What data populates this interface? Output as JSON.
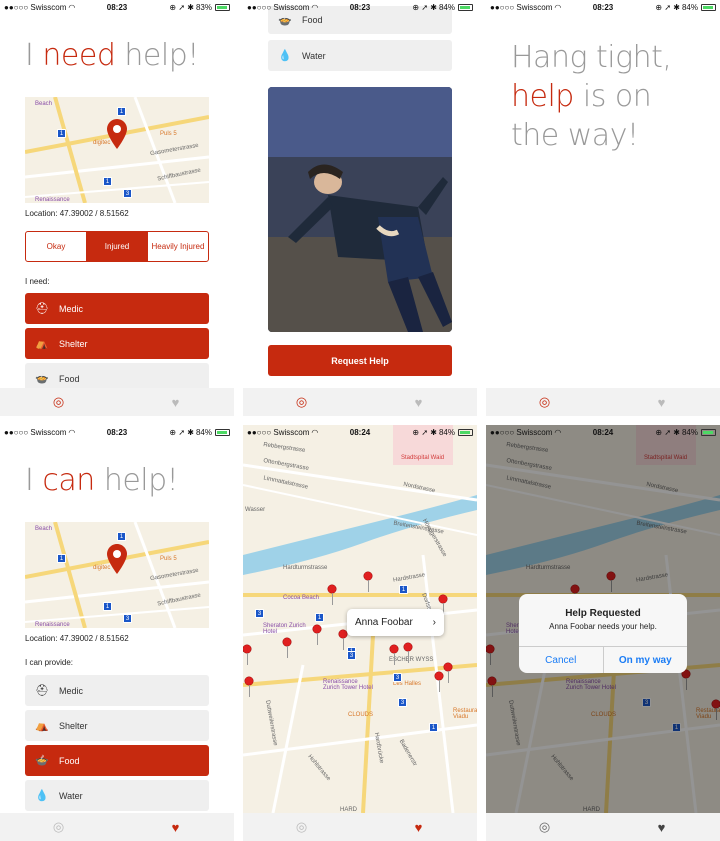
{
  "status": {
    "carrier": "●●○○○ Swisscom",
    "times": [
      "08:23",
      "08:23",
      "08:23",
      "08:23",
      "08:24",
      "08:24"
    ],
    "battery": [
      "83%",
      "84%",
      "84%",
      "84%",
      "84%",
      "84%"
    ]
  },
  "s1": {
    "title_pre": "I ",
    "title_em": "need",
    "title_post": " help!",
    "location": "Location: 47.39002 / 8.51562",
    "seg": [
      "Okay",
      "Injured",
      "Heavily Injured"
    ],
    "need_label": "I need:",
    "options": [
      "Medic",
      "Shelter",
      "Food"
    ]
  },
  "s2": {
    "options": [
      "Food",
      "Water"
    ],
    "request": "Request Help"
  },
  "s3": {
    "line1": "Hang tight,",
    "em": "help",
    "line2rest": " is on",
    "line3": "the way!"
  },
  "s4": {
    "title_pre": "I ",
    "title_em": "can",
    "title_post": " help!",
    "location": "Location: 47.39002 / 8.51562",
    "provide_label": "I can provide:",
    "options": [
      "Medic",
      "Shelter",
      "Food",
      "Water"
    ]
  },
  "s5": {
    "callout": "Anna Foobar"
  },
  "s6": {
    "alert_title": "Help Requested",
    "alert_msg": "Anna Foobar needs your help.",
    "cancel": "Cancel",
    "ok": "On my way"
  },
  "map_small": {
    "labels": [
      "Puls 5",
      "digitec",
      "Gasometerstrasse",
      "Schiffbaustrasse",
      "Renaissance",
      "Beach"
    ]
  },
  "map_large": {
    "streets": [
      "Rebbergstrasse",
      "Ottenbergstrasse",
      "Limmattalstrasse",
      "Nordstrasse",
      "Wasser",
      "Breitensteinstrasse",
      "Hönggerstrasse",
      "Hardturmstrasse",
      "Hardstrasse",
      "Dorfstrasse",
      "Duttweilerstrasse",
      "Hohlstrasse",
      "Badenerstr",
      "Hardbrücke",
      "HARD",
      "ESCHER WYSS"
    ],
    "pois": [
      "Stadtspital Waid",
      "Cocoa Beach",
      "Sheraton Zurich Hotel",
      "Renaissance Zurich Tower Hotel",
      "Les Halles",
      "CLOUDS",
      "Restaurant Viadu"
    ]
  },
  "colors": {
    "accent": "#c62a0f",
    "blue": "#1a7cf5"
  },
  "icons": {
    "lifebuoy": "lifebuoy-icon",
    "heart": "heart-icon"
  }
}
